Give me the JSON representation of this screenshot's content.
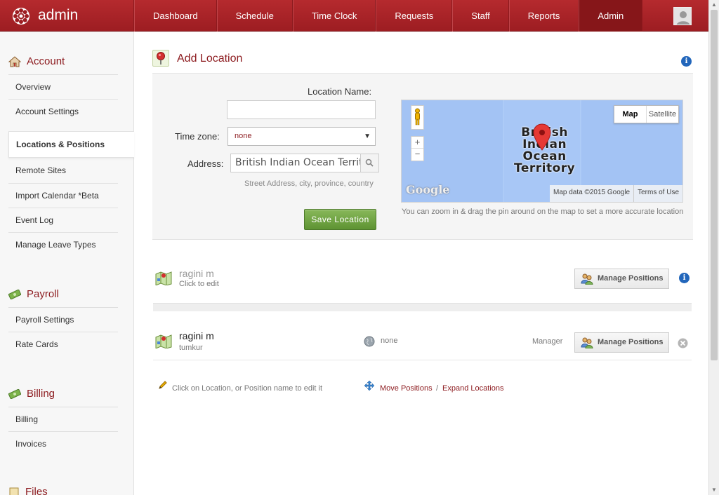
{
  "header": {
    "brand": "admin",
    "nav": [
      "Dashboard",
      "Schedule",
      "Time Clock",
      "Requests",
      "Staff",
      "Reports",
      "Admin"
    ],
    "active_nav": "Admin"
  },
  "sidebar": {
    "account": {
      "heading": "Account",
      "items": [
        "Overview",
        "Account Settings",
        "Locations & Positions",
        "Remote Sites",
        "Import Calendar *Beta",
        "Event Log",
        "Manage Leave Types"
      ]
    },
    "payroll": {
      "heading": "Payroll",
      "items": [
        "Payroll Settings",
        "Rate Cards"
      ]
    },
    "billing": {
      "heading": "Billing",
      "items": [
        "Billing",
        "Invoices"
      ]
    },
    "files": {
      "heading": "Files"
    }
  },
  "main": {
    "title": "Add Location",
    "form": {
      "location_name_label": "Location Name:",
      "location_name_value": "",
      "timezone_label": "Time zone:",
      "timezone_value": "none",
      "address_label": "Address:",
      "address_value": "British Indian Ocean Territor",
      "address_hint": "Street Address, city, province, country",
      "save_label": "Save Location"
    },
    "map": {
      "type_map": "Map",
      "type_satellite": "Satellite",
      "place_label_1": "British",
      "place_label_2": "Indian",
      "place_label_3": "Ocean",
      "place_label_4": "Territory",
      "google": "Google",
      "map_data": "Map data ©2015 Google",
      "terms": "Terms of Use",
      "zoom_in": "+",
      "zoom_out": "−",
      "hint": "You can zoom in & drag the pin around on the map to set a more accurate location"
    },
    "locations": [
      {
        "name": "ragini m",
        "sub": "Click to edit",
        "manage_label": "Manage Positions"
      },
      {
        "name": "ragini m",
        "sub": "tumkur",
        "timezone": "none",
        "role": "Manager",
        "manage_label": "Manage Positions"
      }
    ],
    "footer": {
      "hint": "Click on Location, or Position name to edit it",
      "move": "Move Positions",
      "separator": "/",
      "expand": "Expand Locations"
    },
    "info_glyph": "i"
  },
  "colors": {
    "brand_red": "#9d1d22",
    "link_red": "#8c1a1e",
    "save_green": "#5e9333",
    "map_water": "#a3c3f4"
  }
}
